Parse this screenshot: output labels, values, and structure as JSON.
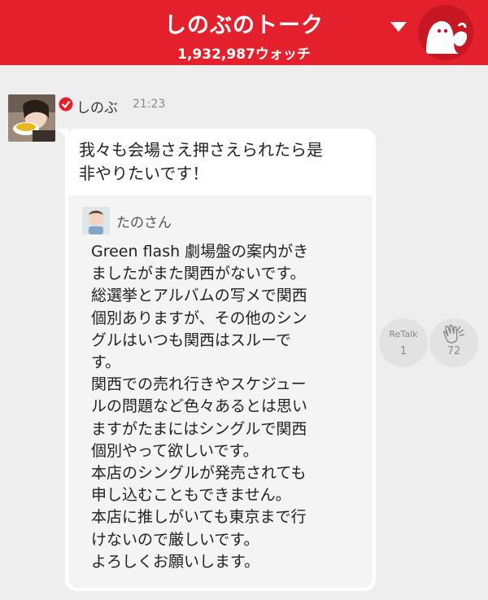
{
  "header": {
    "title": "しのぶのトーク",
    "watch_count": "1,932,987ウォッチ"
  },
  "post": {
    "sender_name": "しのぶ",
    "time": "21:23",
    "message": "我々も会場さえ押さえられたら是\n非やりたいです！",
    "quote": {
      "author": "たのさん",
      "text": "Green flash 劇場盤の案内がき\nましたがまた関西がないです。\n総選挙とアルバムの写メで関西\n個別ありますが、その他のシン\nグルはいつも関西はスルーで\nす。\n関西での売れ行きやスケジュー\nルの問題など色々あるとは思い\nますがたまにはシングルで関西\n個別やって欲しいです。\n本店のシングルが発売されても\n申し込むこともできません。\n本店に推しがいても東京まで行\nけないので厳しいです。\nよろしくお願いします。"
    }
  },
  "actions": {
    "retalk_label": "ReTalk",
    "retalk_count": "1",
    "clap_count": "72"
  },
  "colors": {
    "brand_red": "#e3202b",
    "background": "#eeeeee",
    "bubble": "#ffffff",
    "quote_bg": "#f4f4f4"
  },
  "icons": {
    "dropdown": "chevron-down-icon",
    "profile": "ghost-icon",
    "verified": "verified-check-icon",
    "clap": "clap-icon"
  }
}
